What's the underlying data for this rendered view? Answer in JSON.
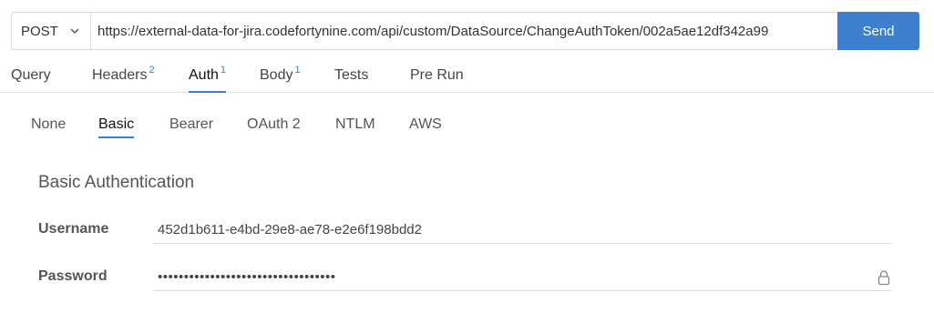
{
  "request": {
    "method": "POST",
    "url": "https://external-data-for-jira.codefortynine.com/api/custom/DataSource/ChangeAuthToken/002a5ae12df342a99",
    "send_label": "Send"
  },
  "main_tabs": [
    {
      "label": "Query",
      "badge": ""
    },
    {
      "label": "Headers",
      "badge": "2"
    },
    {
      "label": "Auth",
      "badge": "1"
    },
    {
      "label": "Body",
      "badge": "1"
    },
    {
      "label": "Tests",
      "badge": ""
    },
    {
      "label": "Pre Run",
      "badge": ""
    }
  ],
  "auth_tabs": [
    {
      "label": "None"
    },
    {
      "label": "Basic"
    },
    {
      "label": "Bearer"
    },
    {
      "label": "OAuth 2"
    },
    {
      "label": "NTLM"
    },
    {
      "label": "AWS"
    }
  ],
  "basic_auth": {
    "heading": "Basic Authentication",
    "username_label": "Username",
    "username_value": "452d1b611-e4bd-29e8-ae78-e2e6f198bdd2",
    "password_label": "Password",
    "password_value": "••••••••••••••••••••••••••••••••••"
  },
  "colors": {
    "accent": "#3b7fce",
    "send_button": "#3b7fce"
  },
  "icons": {
    "method_dropdown": "chevron-down-icon",
    "password_lock": "lock-icon"
  }
}
